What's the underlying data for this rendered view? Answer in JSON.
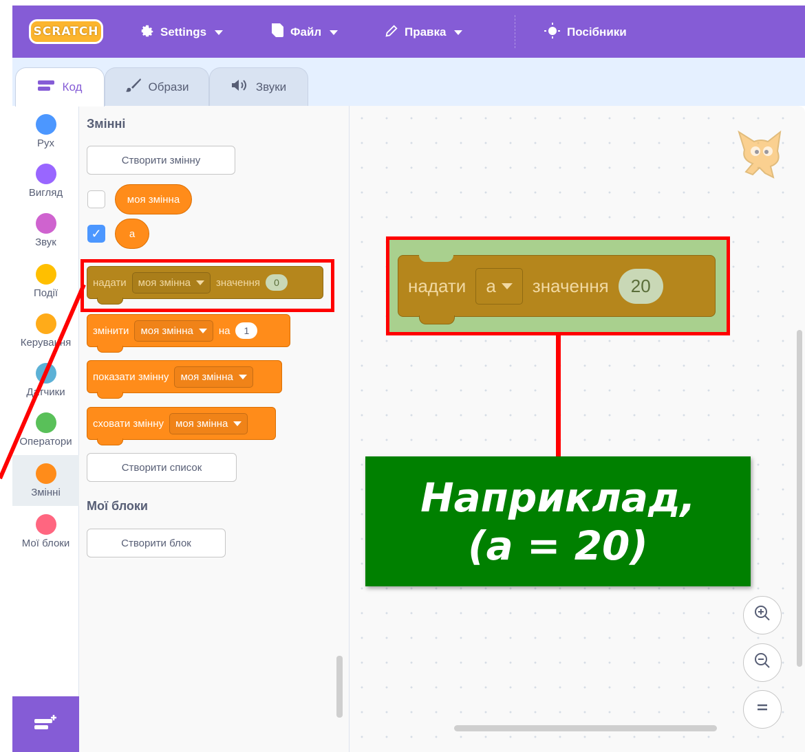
{
  "menubar": {
    "logo": "SCRATCH",
    "settings": "Settings",
    "file": "Файл",
    "edit": "Правка",
    "tutorials": "Посібники"
  },
  "tabs": [
    {
      "label": "Код",
      "active": true
    },
    {
      "label": "Образи",
      "active": false
    },
    {
      "label": "Звуки",
      "active": false
    }
  ],
  "categories": [
    {
      "label": "Рух",
      "color": "#4c97ff"
    },
    {
      "label": "Вигляд",
      "color": "#9966ff"
    },
    {
      "label": "Звук",
      "color": "#cf63cf"
    },
    {
      "label": "Події",
      "color": "#ffbf00"
    },
    {
      "label": "Керування",
      "color": "#ffab19"
    },
    {
      "label": "Датчики",
      "color": "#5cb1d6"
    },
    {
      "label": "Оператори",
      "color": "#59c059"
    },
    {
      "label": "Змінні",
      "color": "#ff8c1a"
    },
    {
      "label": "Мої блоки",
      "color": "#ff6680"
    }
  ],
  "palette": {
    "variables_title": "Змінні",
    "make_variable": "Створити змінну",
    "var_my": "моя змінна",
    "var_a": "a",
    "set_block": {
      "label": "надати",
      "var": "моя змінна",
      "to": "значення",
      "value": "0"
    },
    "change_block": {
      "label": "змінити",
      "var": "моя змінна",
      "by": "на",
      "value": "1"
    },
    "show_block": {
      "label": "показати змінну",
      "var": "моя змінна"
    },
    "hide_block": {
      "label": "сховати змінну",
      "var": "моя змінна"
    },
    "make_list": "Створити список",
    "myblocks_title": "Мої блоки",
    "make_block": "Створити блок"
  },
  "workspace": {
    "block": {
      "label": "надати",
      "var": "a",
      "to": "значення",
      "value": "20"
    },
    "example_line1": "Наприклад,",
    "example_line2": "(a = 20)"
  },
  "colors": {
    "menubar": "#855cd6",
    "variables": "#ff8c1a",
    "highlight": "#ff0000",
    "example_bg": "#008000"
  }
}
